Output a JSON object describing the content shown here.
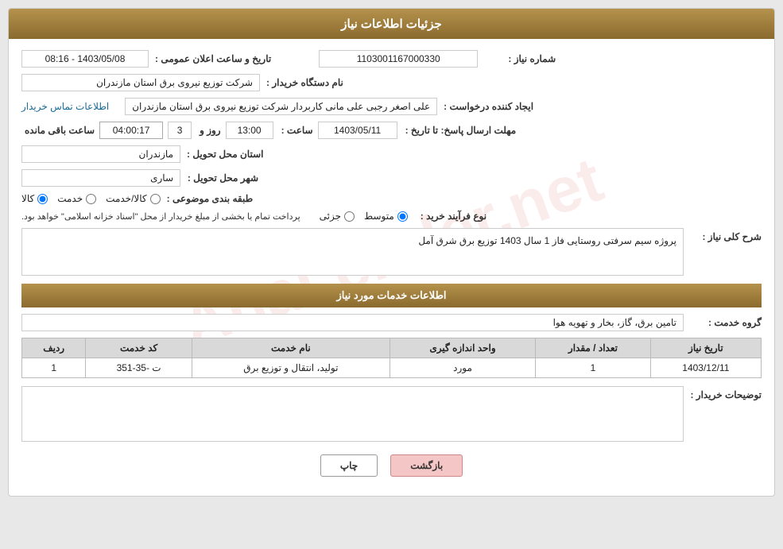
{
  "header": {
    "title": "جزئیات اطلاعات نیاز"
  },
  "fields": {
    "shomareNiaz_label": "شماره نیاز :",
    "shomareNiaz_value": "1103001167000330",
    "namDastgah_label": "نام دستگاه خریدار :",
    "namDastgah_value": "شرکت توزیع نیروی برق استان مازندران",
    "ijadKonande_label": "ایجاد کننده درخواست :",
    "ijadKonande_value": "علی اصغر رجبی علی مانی کاربردار شرکت توزیع نیروی برق استان مازندران",
    "contactInfo_link": "اطلاعات تماس خریدار",
    "mohlatErsalLabel": "مهلت ارسال پاسخ: تا تاریخ :",
    "arsalDate": "1403/05/11",
    "arsalSaat_label": "ساعت :",
    "arsalSaat": "13:00",
    "arsalRooz_label": "روز و",
    "arsalRooz": "3",
    "arsalRemaining_label": "ساعت باقی مانده",
    "arsalRemaining": "04:00:17",
    "dateAelanLabel": "تاریخ و ساعت اعلان عمومی :",
    "dateAelan": "1403/05/08 - 08:16",
    "ostan_label": "استان محل تحویل :",
    "ostan_value": "مازندران",
    "shahr_label": "شهر محل تحویل :",
    "shahr_value": "ساری",
    "tabaqebandi_label": "طبقه بندی موضوعی :",
    "tabaqe_kala": "کالا",
    "tabaqe_khedmat": "خدمت",
    "tabaqe_kala_khedmat": "کالا/خدمت",
    "noeFarayand_label": "نوع فرآیند خرید :",
    "farayand_jozi": "جزئی",
    "farayand_mootasat": "متوسط",
    "farayand_note": "پرداخت تمام یا بخشی از مبلغ خریدار از محل \"اسناد خزانه اسلامی\" خواهد بود.",
    "sharhKoli_label": "شرح کلی نیاز :",
    "sharhKoli_value": "پروژه سیم سرفتی روستایی فاز 1 سال 1403 توزیع برق شرق آمل",
    "khadamatSection_title": "اطلاعات خدمات مورد نیاز",
    "groupKhedmat_label": "گروه خدمت :",
    "groupKhedmat_value": "تامین برق، گاز، بخار و تهویه هوا",
    "table": {
      "headers": [
        "ردیف",
        "کد خدمت",
        "نام خدمت",
        "واحد اندازه گیری",
        "تعداد / مقدار",
        "تاریخ نیاز"
      ],
      "rows": [
        {
          "radif": "1",
          "kodKhedmat": "ت -35-351",
          "namKhedmat": "تولید، انتقال و توزیع برق",
          "vahed": "مورد",
          "tedad": "1",
          "tarikh": "1403/12/11"
        }
      ]
    },
    "toozihat_label": "توضیحات خریدار :"
  },
  "buttons": {
    "print": "چاپ",
    "back": "بازگشت"
  }
}
